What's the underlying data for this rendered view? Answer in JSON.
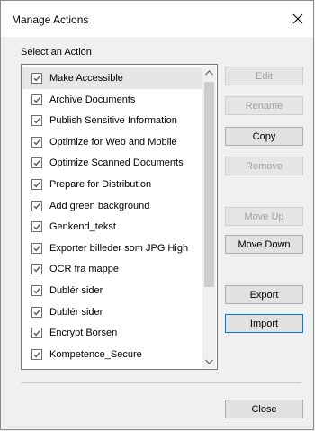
{
  "dialog": {
    "title": "Manage Actions",
    "section_label": "Select an Action"
  },
  "actions": [
    {
      "label": "Make Accessible",
      "checked": true,
      "selected": true
    },
    {
      "label": "Archive Documents",
      "checked": true,
      "selected": false
    },
    {
      "label": "Publish Sensitive Information",
      "checked": true,
      "selected": false
    },
    {
      "label": "Optimize for Web and Mobile",
      "checked": true,
      "selected": false
    },
    {
      "label": "Optimize Scanned Documents",
      "checked": true,
      "selected": false
    },
    {
      "label": "Prepare for Distribution",
      "checked": true,
      "selected": false
    },
    {
      "label": "Add green background",
      "checked": true,
      "selected": false
    },
    {
      "label": "Genkend_tekst",
      "checked": true,
      "selected": false
    },
    {
      "label": "Exporter billeder som JPG High",
      "checked": true,
      "selected": false
    },
    {
      "label": "OCR fra mappe",
      "checked": true,
      "selected": false
    },
    {
      "label": "Dublér sider",
      "checked": true,
      "selected": false
    },
    {
      "label": "Dublér sider",
      "checked": true,
      "selected": false
    },
    {
      "label": "Encrypt Borsen",
      "checked": true,
      "selected": false
    },
    {
      "label": "Kompetence_Secure",
      "checked": true,
      "selected": false
    }
  ],
  "buttons": {
    "edit": "Edit",
    "rename": "Rename",
    "copy": "Copy",
    "remove": "Remove",
    "move_up": "Move Up",
    "move_down": "Move Down",
    "export": "Export",
    "import": "Import",
    "close": "Close"
  },
  "icons": {
    "close": "close-icon",
    "checkbox": "checkmark-icon",
    "scroll_up": "chevron-up-icon",
    "scroll_down": "chevron-down-icon"
  },
  "colors": {
    "selected_row": "#e6e6e6",
    "focus_border": "#0078d7",
    "disabled_text": "#a0a0a0"
  }
}
